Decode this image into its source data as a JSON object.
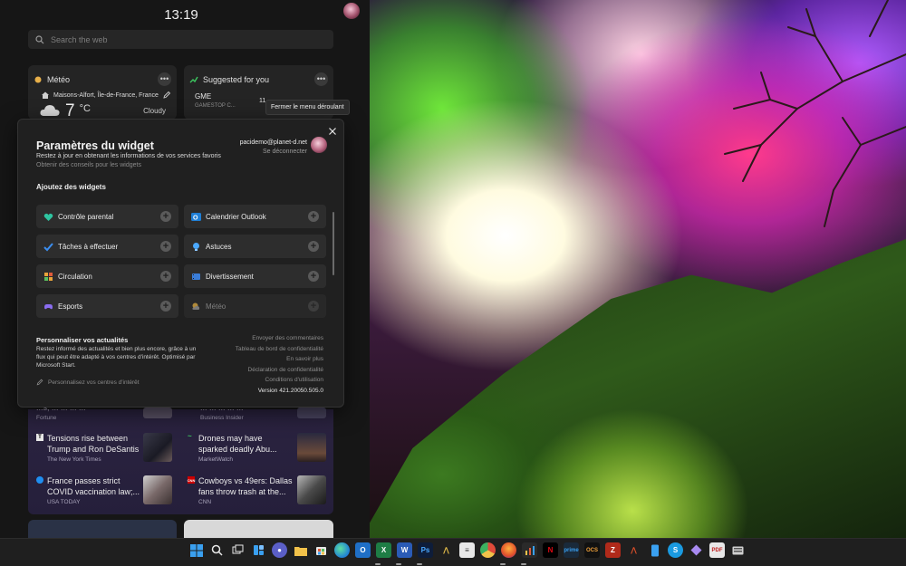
{
  "panel": {
    "clock": "13:19",
    "search_placeholder": "Search the web"
  },
  "weather_card": {
    "title": "Météo",
    "location": "Maisons-Alfort, Île-de-France, France",
    "temperature": "7",
    "unit": "°C",
    "condition": "Cloudy"
  },
  "suggested_card": {
    "title": "Suggested for you",
    "ticker": "GME",
    "company": "GAMESTOP C...",
    "value": "11..."
  },
  "tooltip": "Fermer le menu déroulant",
  "dialog": {
    "title": "Paramètres du widget",
    "subtitle": "Restez à jour en obtenant les informations de vos services favoris",
    "subtitle2": "Obtenir des conseils pour les widgets",
    "account_email": "pacidemo@planet-d.net",
    "sign_out": "Se déconnecter",
    "add_widgets_heading": "Ajoutez des widgets",
    "widgets": [
      {
        "label": "Contrôle parental",
        "icon": "heart-icon",
        "color": "#2ec4a0",
        "enabled": true
      },
      {
        "label": "Calendrier Outlook",
        "icon": "outlook-icon",
        "color": "#1f7fd6",
        "enabled": true
      },
      {
        "label": "Tâches à effectuer",
        "icon": "todo-check-icon",
        "color": "#3b8ef0",
        "enabled": true
      },
      {
        "label": "Astuces",
        "icon": "lightbulb-icon",
        "color": "#4aa8ff",
        "enabled": true
      },
      {
        "label": "Circulation",
        "icon": "traffic-icon",
        "color": "#e8a33a",
        "enabled": true
      },
      {
        "label": "Divertissement",
        "icon": "film-icon",
        "color": "#3a7dd8",
        "enabled": true
      },
      {
        "label": "Esports",
        "icon": "gamepad-icon",
        "color": "#8a6df0",
        "enabled": true
      },
      {
        "label": "Météo",
        "icon": "weather-icon",
        "color": "#e8b04a",
        "enabled": false
      }
    ],
    "personalize_heading": "Personnaliser vos actualités",
    "personalize_body": "Restez informé des actualités et bien plus encore, grâce à un flux qui peut être adapté à vos centres d'intérêt. Optimisé par Microsoft Start.",
    "personalize_link": "Personnalisez vos centres d'intérêt",
    "links": [
      "Envoyer des commentaires",
      "Tableau de bord de confidentialité",
      "En savoir plus",
      "Déclaration de confidentialité",
      "Conditions d'utilisation"
    ],
    "version": "Version 421.20050.505.0"
  },
  "news": [
    {
      "title": "Tensions rise between Trump and Ron DeSantis",
      "source": "The New York Times"
    },
    {
      "title": "Drones may have sparked deadly Abu...",
      "source": "MarketWatch"
    },
    {
      "title": "France passes strict COVID vaccination law;...",
      "source": "USA TODAY"
    },
    {
      "title": "Cowboys vs 49ers: Dallas fans throw trash at the...",
      "source": "CNN"
    }
  ],
  "news_partial": [
    {
      "title": "...s, ... ... ... ...",
      "source": "Fortune"
    },
    {
      "title": "... ... ... ... ...",
      "source": "Business Insider"
    }
  ]
}
